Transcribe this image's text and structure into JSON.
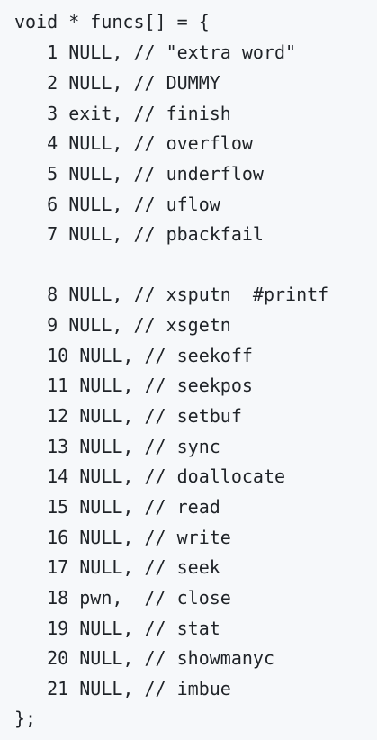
{
  "code": {
    "lines": [
      "void * funcs[] = {",
      "   1 NULL, // \"extra word\"",
      "   2 NULL, // DUMMY",
      "   3 exit, // finish",
      "   4 NULL, // overflow",
      "   5 NULL, // underflow",
      "   6 NULL, // uflow",
      "   7 NULL, // pbackfail",
      "",
      "   8 NULL, // xsputn  #printf",
      "   9 NULL, // xsgetn",
      "   10 NULL, // seekoff",
      "   11 NULL, // seekpos",
      "   12 NULL, // setbuf",
      "   13 NULL, // sync",
      "   14 NULL, // doallocate",
      "   15 NULL, // read",
      "   16 NULL, // write",
      "   17 NULL, // seek",
      "   18 pwn,  // close",
      "   19 NULL, // stat",
      "   20 NULL, // showmanyc",
      "   21 NULL, // imbue",
      "};"
    ]
  }
}
